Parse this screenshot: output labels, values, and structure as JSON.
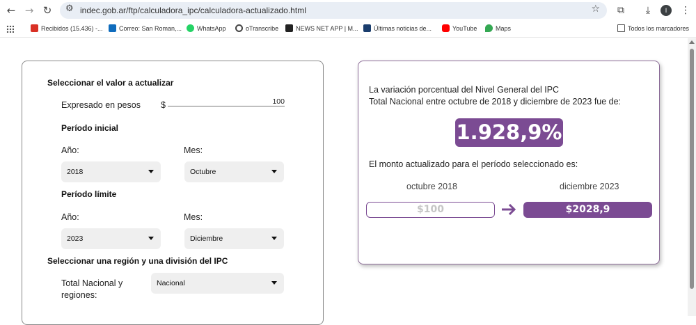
{
  "browser": {
    "url": "indec.gob.ar/ftp/calculadora_ipc/calculadora-actualizado.html",
    "profile_initial": "I",
    "bookmarks": [
      {
        "label": "Recibidos (15.436) -...",
        "icon": "gmail-icon",
        "color": "#d93025"
      },
      {
        "label": "Correo: San Roman,...",
        "icon": "outlook-icon",
        "color": "#0f6cbd"
      },
      {
        "label": "WhatsApp",
        "icon": "whatsapp-icon",
        "color": "#25d366"
      },
      {
        "label": "oTranscribe",
        "icon": "otranscribe-icon",
        "color": "#444444"
      },
      {
        "label": "NEWS NET APP | M...",
        "icon": "newsnet-icon",
        "color": "#222222"
      },
      {
        "label": "Últimas noticias de...",
        "icon": "ln-icon",
        "color": "#1a3d6d"
      },
      {
        "label": "YouTube",
        "icon": "youtube-icon",
        "color": "#ff0000"
      },
      {
        "label": "Maps",
        "icon": "maps-icon",
        "color": "#34a853"
      }
    ],
    "all_bookmarks_label": "Todos los marcadores"
  },
  "form": {
    "section_value": "Seleccionar el valor a actualizar",
    "amount_label": "Expresado en pesos",
    "currency_symbol": "$",
    "amount_value": "100",
    "initial_period_title": "Período inicial",
    "initial_year_label": "Año:",
    "initial_month_label": "Mes:",
    "initial_year": "2018",
    "initial_month": "Octubre",
    "limit_period_title": "Período límite",
    "limit_year_label": "Año:",
    "limit_month_label": "Mes:",
    "limit_year": "2023",
    "limit_month": "Diciembre",
    "region_section": "Seleccionar una región y una división del IPC",
    "region_label_line1": "Total Nacional y",
    "region_label_line2": "regiones:",
    "region_value": "Nacional"
  },
  "result": {
    "line1": "La variación porcentual del Nivel General del IPC",
    "line2": "Total Nacional entre octubre de 2018 y diciembre de 2023 fue de:",
    "percentage": "1.928,9%",
    "amount_text": "El monto actualizado para el período seleccionado es:",
    "from_period": "octubre 2018",
    "to_period": "diciembre 2023",
    "from_amount": "$100",
    "to_amount": "$2028,9"
  },
  "colors": {
    "accent": "#7b4b93"
  }
}
